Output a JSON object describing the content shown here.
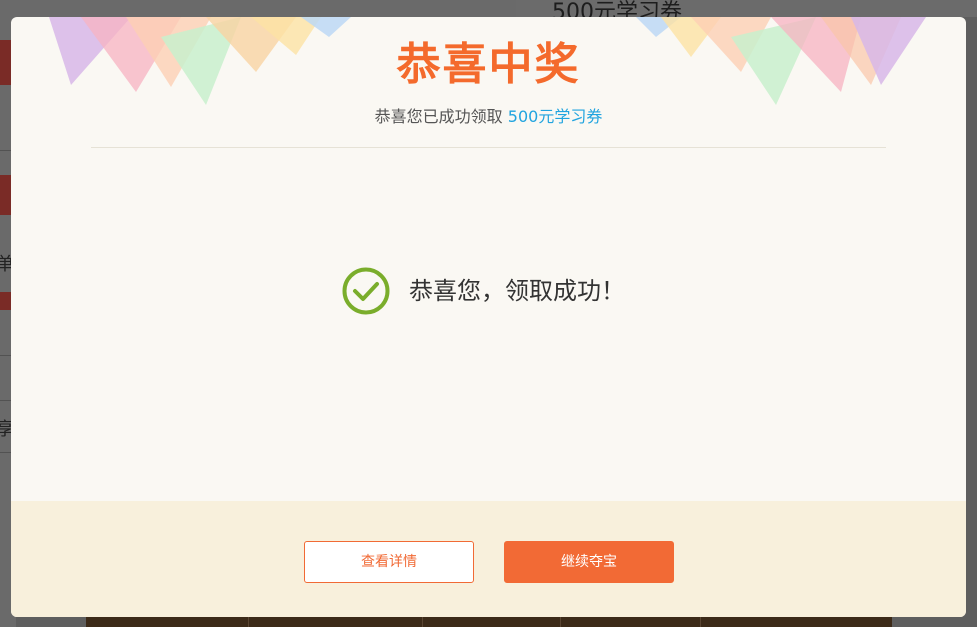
{
  "background": {
    "top_title": "500元学习券",
    "side_chars": [
      "单",
      "享"
    ]
  },
  "modal": {
    "title": "恭喜中奖",
    "subtitle_prefix": "恭喜您已成功领取",
    "subtitle_highlight": "500元学习券",
    "success_message": "恭喜您，领取成功！",
    "buttons": {
      "details": "查看详情",
      "continue": "继续夺宝"
    }
  },
  "colors": {
    "title": "#f46a2c",
    "highlight": "#21a4df",
    "check": "#7aad2b",
    "primary_button": "#f26a35",
    "footer_bg": "#f8f0dc"
  },
  "icons": {
    "success": "check-circle-icon"
  }
}
